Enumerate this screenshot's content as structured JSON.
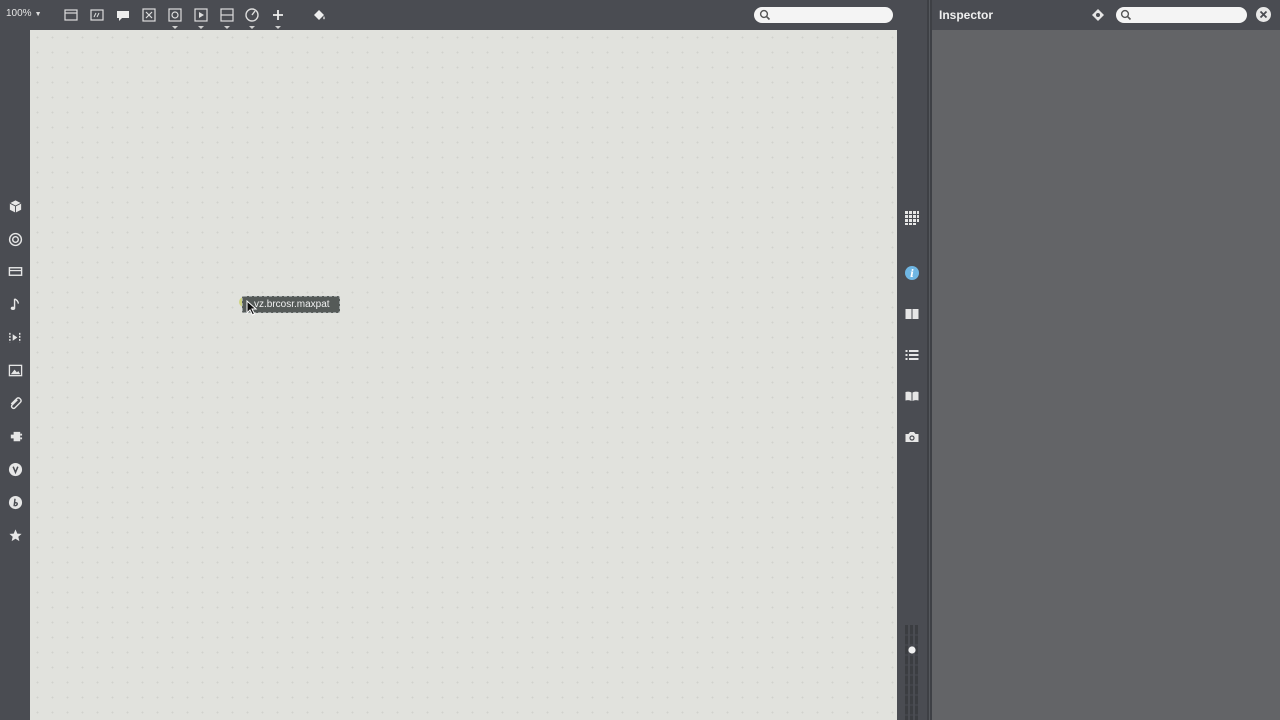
{
  "toolbar": {
    "zoom_label": "100%",
    "search_placeholder": "",
    "icons": [
      "presentation-icon",
      "object-box-icon",
      "comment-icon",
      "message-box-icon",
      "toggle-icon",
      "button-icon",
      "number-icon",
      "dial-icon",
      "add-icon",
      "paint-bucket-icon"
    ]
  },
  "left_sidebar": {
    "icons": [
      "package-icon",
      "circle-target-icon",
      "device-icon",
      "music-note-icon",
      "playlist-icon",
      "image-icon",
      "paperclip-icon",
      "plugin-icon",
      "vizzie-icon",
      "beap-icon",
      "favorites-star-icon"
    ]
  },
  "canvas": {
    "dragged_object_label": "vz.brcosr.maxpat"
  },
  "right_strip": {
    "icons": [
      "grid-icon",
      "info-icon",
      "panels-icon",
      "list-icon",
      "reference-book-icon",
      "snapshot-camera-icon"
    ]
  },
  "inspector": {
    "title": "Inspector",
    "search_placeholder": ""
  },
  "colors": {
    "chrome": "#4a4c52",
    "canvas": "#e1e2dd",
    "inspector_bg": "#636467",
    "accent_info": "#6fb6e3",
    "inlet_highlight": "#cdd37a"
  }
}
